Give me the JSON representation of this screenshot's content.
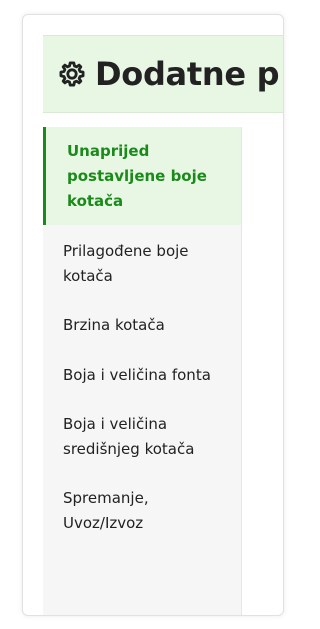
{
  "header": {
    "title": "Dodatne p",
    "icon": "gear-icon"
  },
  "sidebar": {
    "items": [
      {
        "label": "Unaprijed postavljene boje kotača",
        "active": true
      },
      {
        "label": "Prilagođene boje kotača",
        "active": false
      },
      {
        "label": "Brzina kotača",
        "active": false
      },
      {
        "label": "Boja i veličina fonta",
        "active": false
      },
      {
        "label": "Boja i veličina središnjeg kotača",
        "active": false
      },
      {
        "label": "Spremanje, Uvoz/Izvoz",
        "active": false
      }
    ]
  },
  "colors": {
    "accent": "#1b8a1b",
    "header_bg": "#e8f7e4",
    "sidebar_bg": "#f6f6f6"
  }
}
